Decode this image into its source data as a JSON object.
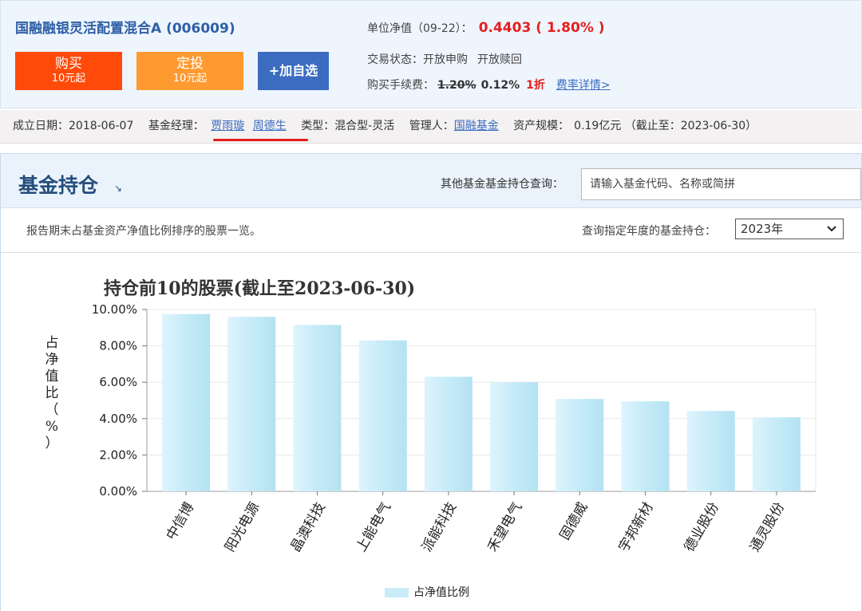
{
  "header": {
    "fund_name": "国融融银灵活配置混合A (006009)",
    "buy": {
      "label": "购买",
      "sub": "10元起"
    },
    "invest": {
      "label": "定投",
      "sub": "10元起"
    },
    "favorite": {
      "label": "+加自选"
    },
    "nav_label": "单位净值（09-22）：",
    "nav_value": "0.4403 ( 1.80% )",
    "status_label": "交易状态：",
    "status_buy": "开放申购",
    "status_redeem": "开放赎回",
    "fee_label": "购买手续费：",
    "fee_old": "1.20%",
    "fee_new": "0.12%",
    "fee_discount": "1折",
    "fee_link": "费率详情>",
    "accent_red": "#e61e1e",
    "buy_color": "#ff4a0a",
    "invest_color": "#ff9a30",
    "fav_color": "#3b6cc0"
  },
  "info": {
    "established_label": "成立日期：",
    "established": "2018-06-07",
    "manager_label": "基金经理：",
    "manager1": "贾雨璇",
    "manager2": "周德生",
    "type_label": "类型：",
    "type": "混合型-灵活",
    "company_label": "管理人：",
    "company": "国融基金",
    "size_label": "资产规模：",
    "size": "0.19亿元 （截止至：2023-06-30）"
  },
  "holdings": {
    "title": "基金持仓",
    "arrow": "↘",
    "search_label": "其他基金基金持仓查询：",
    "search_placeholder": "请输入基金代码、名称或简拼",
    "description": "报告期末占基金资产净值比例排序的股票一览。",
    "year_label": "查询指定年度的基金持仓：",
    "year_value": "2023年",
    "year_chevron_icon": "chevron-down-icon"
  },
  "chart_data": {
    "type": "bar",
    "title": "持仓前10的股票(截止至2023-06-30)",
    "ylabel": "占净值比（%）",
    "ylabel_chars": [
      "占",
      "净",
      "值",
      "比",
      "（",
      "%",
      "）"
    ],
    "categories": [
      "中信博",
      "阳光电源",
      "晶澳科技",
      "上能电气",
      "派能科技",
      "禾望电气",
      "固德威",
      "宇邦新材",
      "德业股份",
      "通灵股份"
    ],
    "series": [
      {
        "name": "占净值比例",
        "values": [
          9.75,
          9.6,
          9.15,
          8.3,
          6.3,
          6.0,
          5.08,
          4.95,
          4.42,
          4.07
        ]
      }
    ],
    "ylim": [
      0,
      10
    ],
    "yticks": [
      0,
      2,
      4,
      6,
      8,
      10
    ],
    "ytick_labels": [
      "0.00%",
      "2.00%",
      "4.00%",
      "6.00%",
      "8.00%",
      "10.00%"
    ],
    "legend": "bottom-center",
    "bar_color": "#c9ecf8",
    "grid": true
  }
}
